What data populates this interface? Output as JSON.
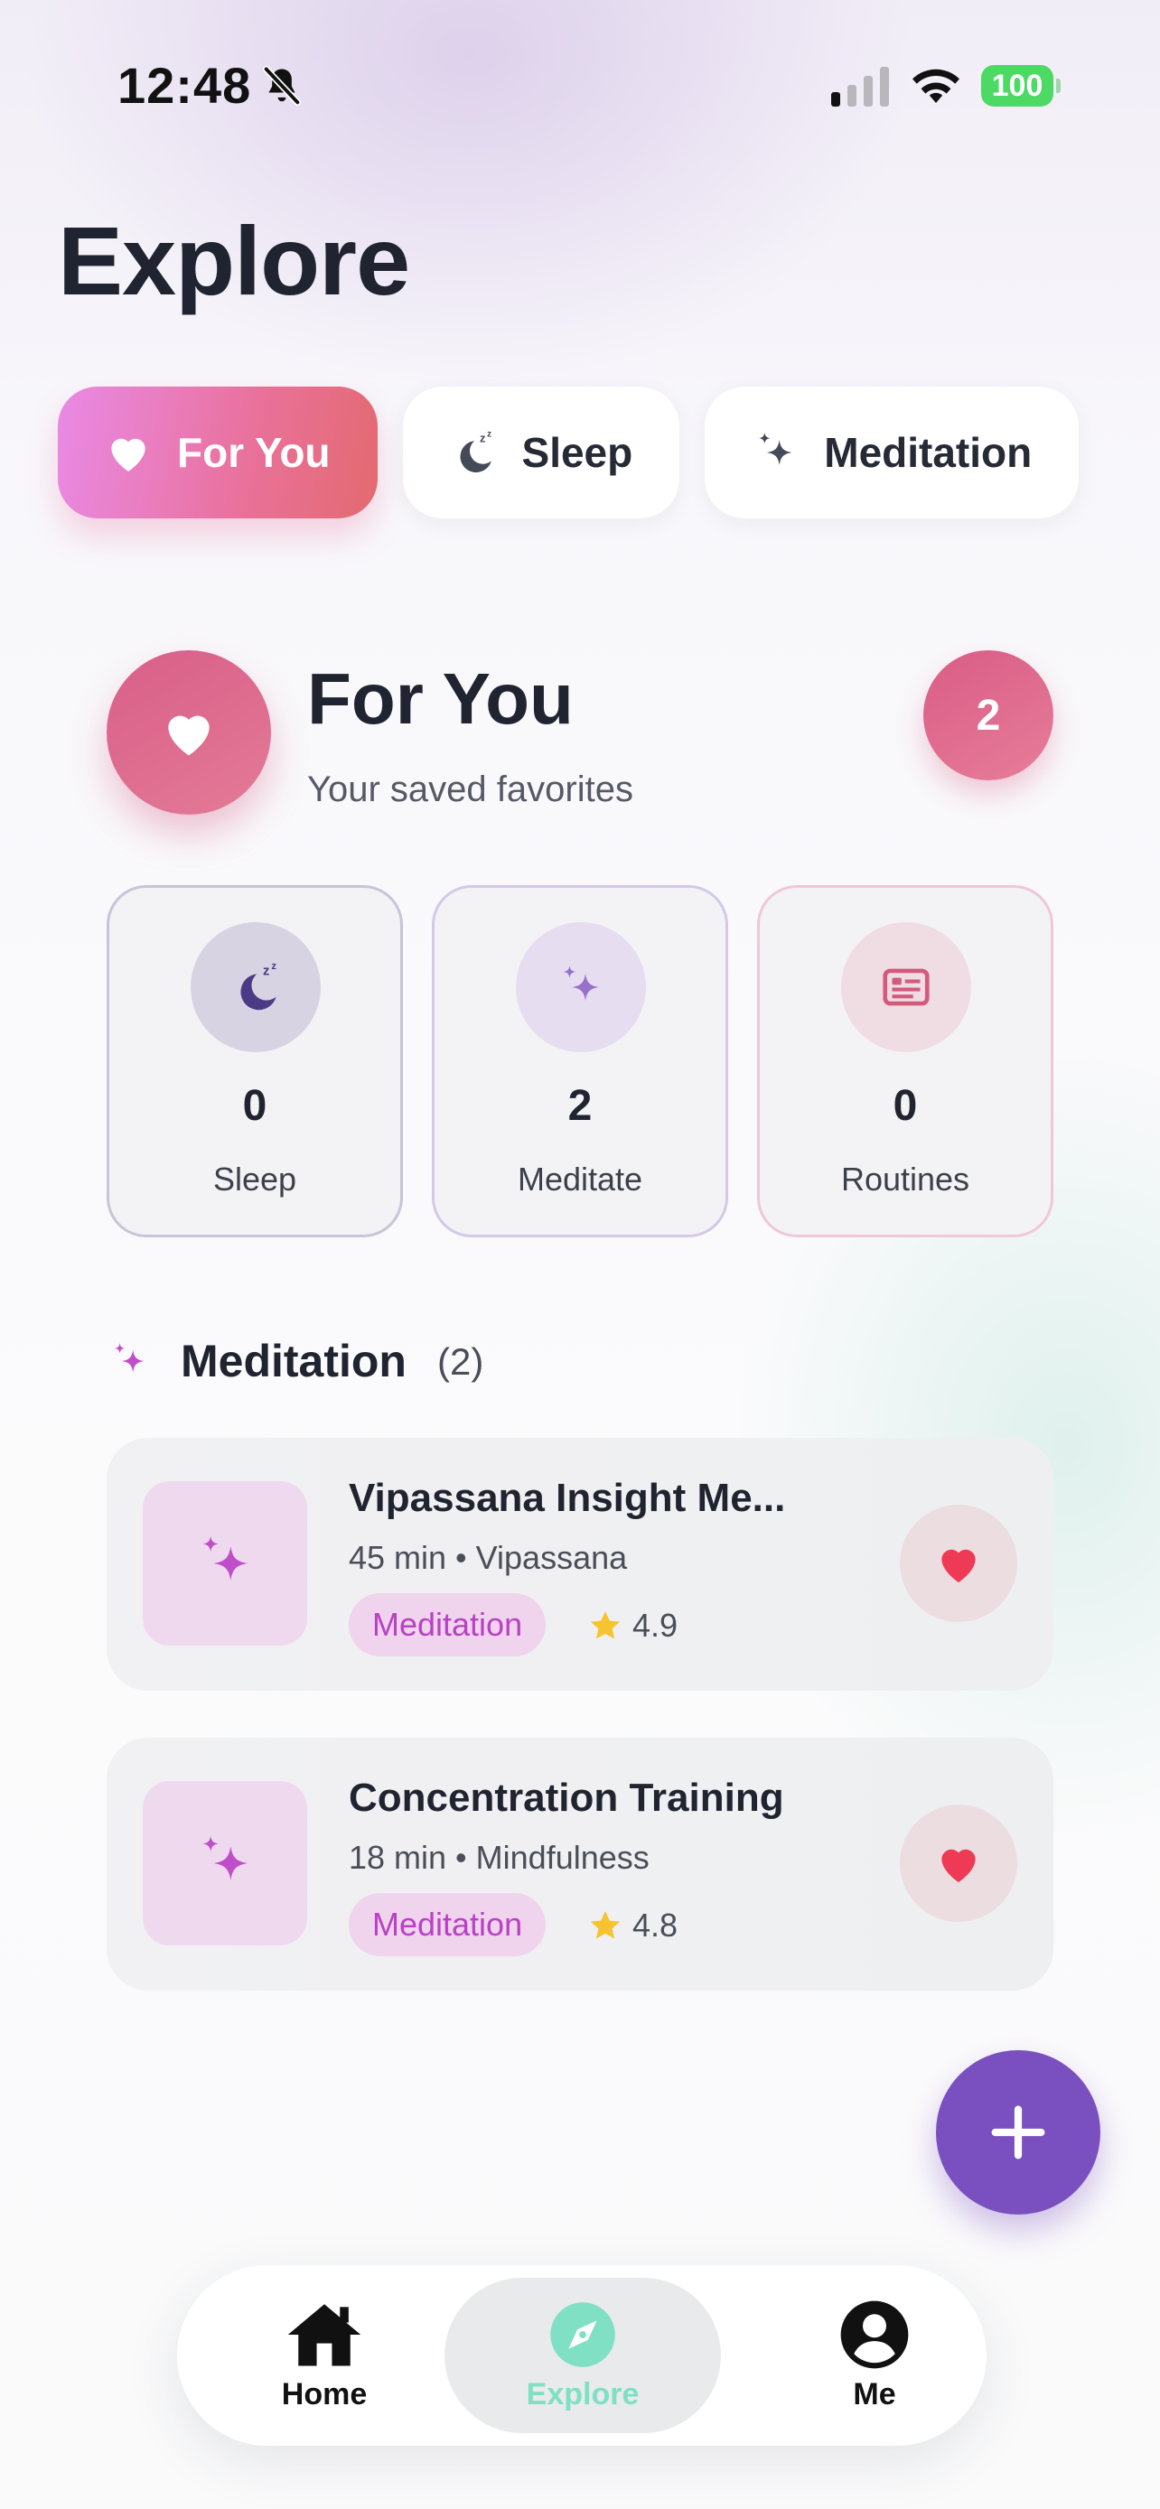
{
  "status_bar": {
    "time": "12:48",
    "battery": "100"
  },
  "page": {
    "title": "Explore"
  },
  "tabs": [
    {
      "label": "For You",
      "icon": "heart-icon",
      "active": true
    },
    {
      "label": "Sleep",
      "icon": "moon-zzz-icon",
      "active": false
    },
    {
      "label": "Meditation",
      "icon": "sparkle-icon",
      "active": false
    }
  ],
  "header": {
    "title": "For You",
    "subtitle": "Your saved favorites",
    "count": "2"
  },
  "stats": [
    {
      "value": "0",
      "label": "Sleep",
      "icon": "moon-zzz-icon"
    },
    {
      "value": "2",
      "label": "Meditate",
      "icon": "sparkle-icon"
    },
    {
      "value": "0",
      "label": "Routines",
      "icon": "list-card-icon"
    }
  ],
  "section": {
    "title": "Meditation",
    "count": "(2)"
  },
  "items": [
    {
      "title": "Vipassana Insight Me...",
      "meta": "45 min • Vipassana",
      "tag": "Meditation",
      "rating": "4.9"
    },
    {
      "title": "Concentration Training",
      "meta": "18 min • Mindfulness",
      "tag": "Meditation",
      "rating": "4.8"
    }
  ],
  "nav": {
    "home": "Home",
    "explore": "Explore",
    "me": "Me"
  },
  "colors": {
    "accent_purple": "#7a4fbf",
    "accent_pink": "#e9719a",
    "explore_active": "#7fe0c3",
    "heart_red": "#ee3a55"
  }
}
